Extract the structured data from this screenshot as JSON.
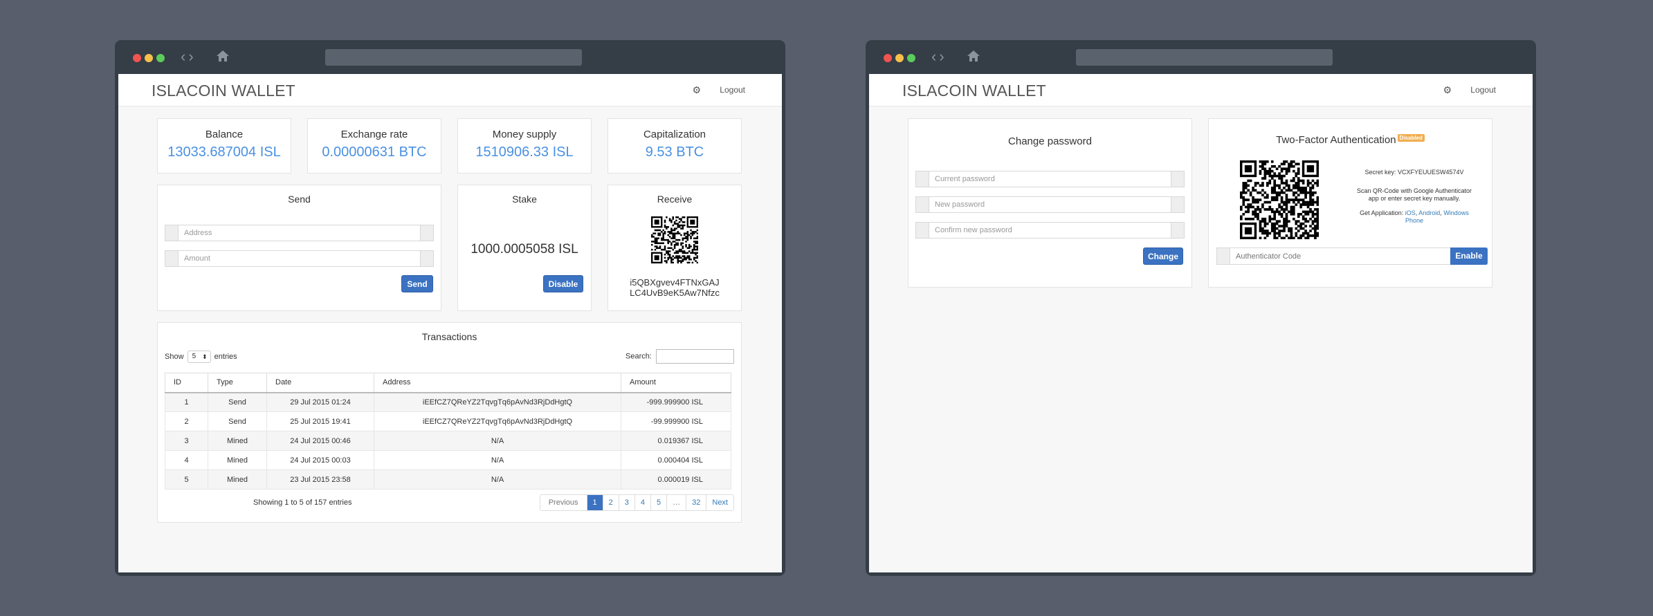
{
  "windows": [
    {
      "brand": "ISLACOIN WALLET",
      "logout": "Logout",
      "stats": [
        {
          "label": "Balance",
          "value": "13033.687004 ISL"
        },
        {
          "label": "Exchange rate",
          "value": "0.00000631 BTC"
        },
        {
          "label": "Money supply",
          "value": "1510906.33 ISL"
        },
        {
          "label": "Capitalization",
          "value": "9.53 BTC"
        }
      ],
      "send": {
        "title": "Send",
        "address_placeholder": "Address",
        "amount_placeholder": "Amount",
        "button": "Send"
      },
      "stake": {
        "title": "Stake",
        "value": "1000.0005058 ISL",
        "button": "Disable"
      },
      "receive": {
        "title": "Receive",
        "address_line1": "i5QBXgvev4FTNxGAJ",
        "address_line2": "LC4UvB9eK5Aw7Nfzc"
      },
      "transactions": {
        "title": "Transactions",
        "show_label": "Show",
        "entries_label": "entries",
        "page_size": "5",
        "search_label": "Search:",
        "columns": [
          "ID",
          "Type",
          "Date",
          "Address",
          "Amount"
        ],
        "rows": [
          {
            "id": "1",
            "type": "Send",
            "date": "29 Jul 2015 01:24",
            "address": "iEEfCZ7QReYZ2TqvgTq6pAvNd3RjDdHgtQ",
            "amount": "-999.999900 ISL"
          },
          {
            "id": "2",
            "type": "Send",
            "date": "25 Jul 2015 19:41",
            "address": "iEEfCZ7QReYZ2TqvgTq6pAvNd3RjDdHgtQ",
            "amount": "-99.999900 ISL"
          },
          {
            "id": "3",
            "type": "Mined",
            "date": "24 Jul 2015 00:46",
            "address": "N/A",
            "amount": "0.019367 ISL"
          },
          {
            "id": "4",
            "type": "Mined",
            "date": "24 Jul 2015 00:03",
            "address": "N/A",
            "amount": "0.000404 ISL"
          },
          {
            "id": "5",
            "type": "Mined",
            "date": "23 Jul 2015 23:58",
            "address": "N/A",
            "amount": "0.000019 ISL"
          }
        ],
        "info": "Showing 1 to 5 of 157 entries",
        "pagination": [
          "Previous",
          "1",
          "2",
          "3",
          "4",
          "5",
          "…",
          "32",
          "Next"
        ]
      }
    },
    {
      "brand": "ISLACOIN WALLET",
      "logout": "Logout",
      "change_password": {
        "title": "Change password",
        "current_placeholder": "Current password",
        "new_placeholder": "New password",
        "confirm_placeholder": "Confirm new password",
        "button": "Change"
      },
      "two_factor": {
        "title": "Two-Factor Authentication",
        "status_badge": "Disabled",
        "secret_key": "Secret key: VCXFYEUUESW4574V",
        "instructions": "Scan QR-Code with Google Authenticator app or enter secret key manually.",
        "get_app_label": "Get Application:",
        "apps": [
          "iOS",
          "Android",
          "Windows Phone"
        ],
        "code_placeholder": "Authenticator Code",
        "button": "Enable"
      }
    }
  ],
  "colors": {
    "background": "#585e6b",
    "window_frame": "#353d47",
    "accent_value": "#4a90e2",
    "primary_button": "#3b72c2",
    "badge": "#f0ad4e"
  },
  "icons": [
    "gear-icon",
    "home-icon",
    "back-icon",
    "forward-icon"
  ]
}
